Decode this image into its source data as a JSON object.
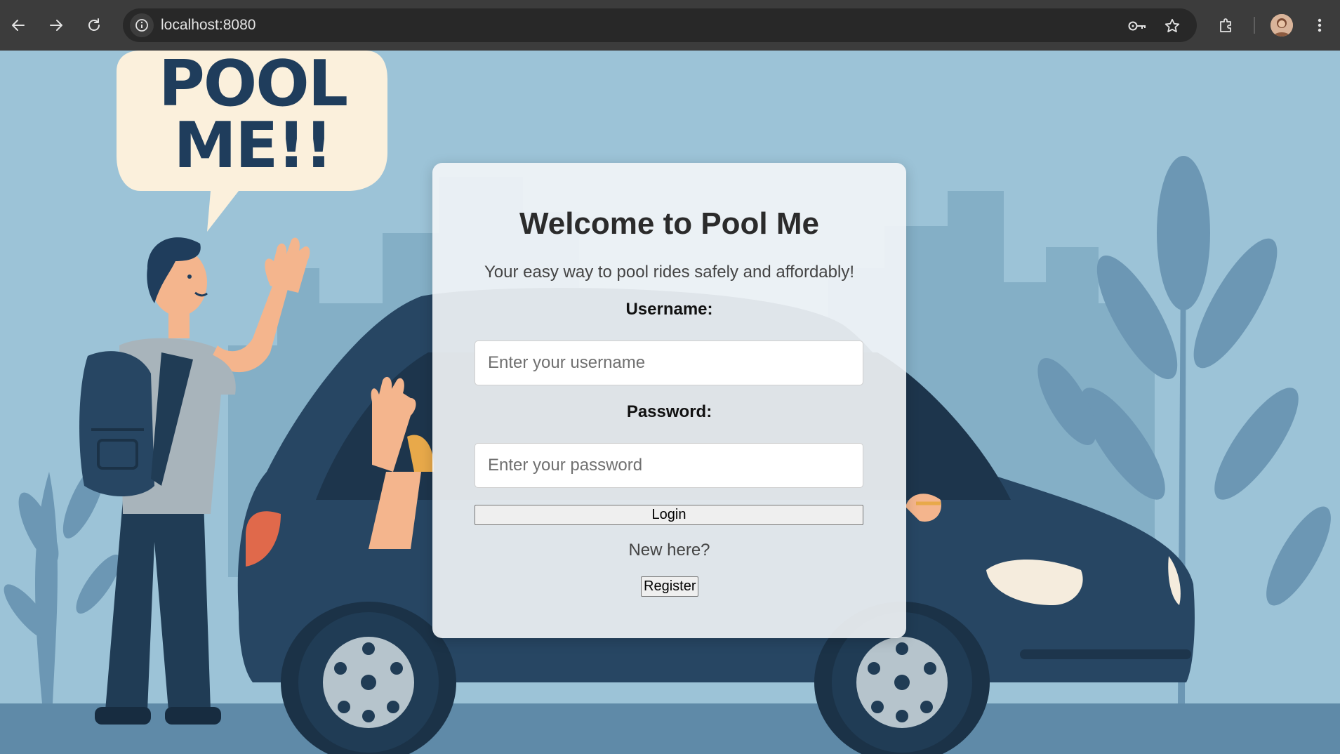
{
  "browser": {
    "url": "localhost:8080",
    "nav_icons": [
      "back-arrow-icon",
      "forward-arrow-icon",
      "reload-icon"
    ],
    "toolbar_icons": [
      "password-key-icon",
      "bookmark-star-icon",
      "extensions-icon",
      "profile-avatar",
      "menu-dots-icon"
    ]
  },
  "background": {
    "speech_bubble_line1": "POOL",
    "speech_bubble_line2": "ME!!"
  },
  "login": {
    "title": "Welcome to Pool Me",
    "subtitle": "Your easy way to pool rides safely and affordably!",
    "username_label": "Username:",
    "username_placeholder": "Enter your username",
    "username_value": "",
    "password_label": "Password:",
    "password_placeholder": "Enter your password",
    "password_value": "",
    "login_button": "Login",
    "new_here_text": "New here?",
    "register_button": "Register"
  },
  "colors": {
    "chrome_bg": "#3c3c3c",
    "omnibox_bg": "#282828",
    "page_bg": "#9cc3d7",
    "car_navy": "#274663",
    "card_bg": "#f4f6f8",
    "title_color": "#2b2b2b"
  }
}
